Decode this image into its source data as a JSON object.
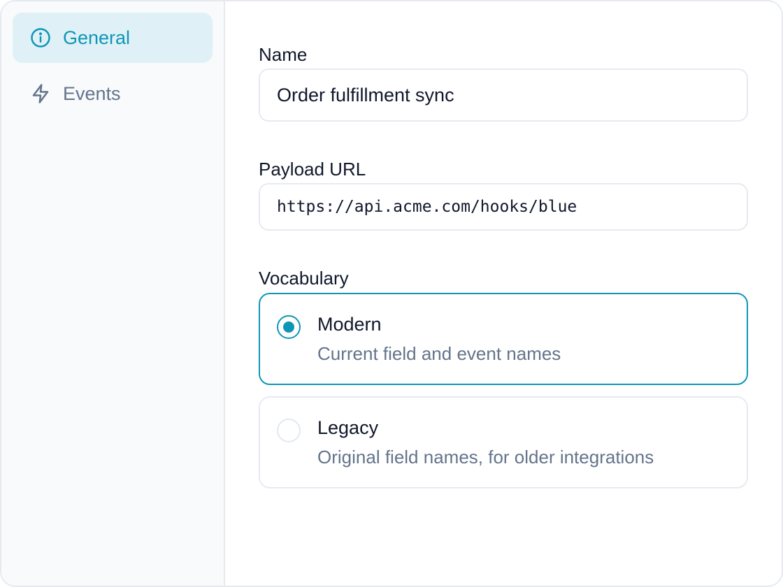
{
  "sidebar": {
    "items": [
      {
        "label": "General",
        "icon": "info-circle-icon",
        "active": true
      },
      {
        "label": "Events",
        "icon": "lightning-bolt-icon",
        "active": false
      }
    ]
  },
  "form": {
    "name": {
      "label": "Name",
      "value": "Order fulfillment sync"
    },
    "payload_url": {
      "label": "Payload URL",
      "value": "https://api.acme.com/hooks/blue"
    },
    "vocabulary": {
      "label": "Vocabulary",
      "options": [
        {
          "title": "Modern",
          "description": "Current field and event names",
          "selected": true
        },
        {
          "title": "Legacy",
          "description": "Original field names, for older integrations",
          "selected": false
        }
      ]
    }
  },
  "colors": {
    "accent": "#0e97b5",
    "active_nav_bg": "#e0f0f7",
    "muted_text": "#64748b",
    "border": "#e6eaf0"
  }
}
